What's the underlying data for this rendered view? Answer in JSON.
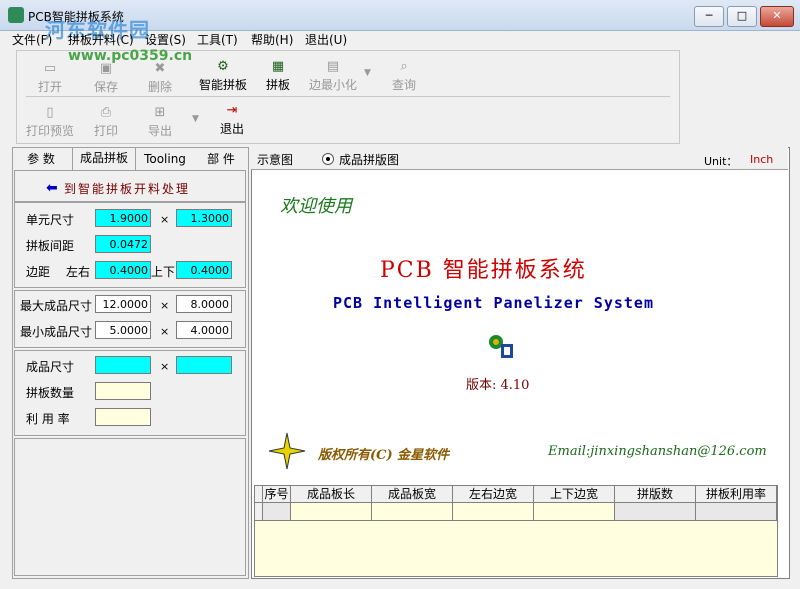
{
  "window": {
    "title": "PCB智能拼板系统"
  },
  "watermark": {
    "text": "河东软件园",
    "url": "www.pc0359.cn"
  },
  "menu": {
    "items": [
      "文件(F)",
      "拼板开料(C)",
      "设置(S)",
      "工具(T)",
      "帮助(H)",
      "退出(U)"
    ]
  },
  "toolbar": {
    "open": "打开",
    "save": "保存",
    "delete": "删除",
    "smart": "智能拼板",
    "panel": "拼板",
    "edge": "边最小化",
    "query": "查询",
    "preview": "打印预览",
    "print": "打印",
    "export": "导出",
    "exit": "退出"
  },
  "tabs": [
    "参 数",
    "成品拼板",
    "Tooling",
    "部 件"
  ],
  "left": {
    "link": "到智能拼板开料处理",
    "unit_size_label": "单元尺寸",
    "unit_w": "1.9000",
    "unit_h": "1.3000",
    "gap_label": "拼板间距",
    "gap": "0.0472",
    "margin_label": "边距",
    "lr_label": "左右",
    "lr": "0.4000",
    "ud_label": "上下",
    "ud": "0.4000",
    "max_label": "最大成品尺寸",
    "max_w": "12.0000",
    "max_h": "8.0000",
    "min_label": "最小成品尺寸",
    "min_w": "5.0000",
    "min_h": "4.0000",
    "prod_label": "成品尺寸",
    "count_label": "拼板数量",
    "usage_label": "利 用 率",
    "times": "×"
  },
  "right": {
    "view1": "示意图",
    "view2": "成品拼版图",
    "unit_label": "Unit：",
    "unit_value": "Inch",
    "welcome": "欢迎使用",
    "title_cn": "PCB 智能拼板系统",
    "title_en": "PCB Intelligent Panelizer System",
    "version": "版本: 4.10",
    "copyright": "版权所有(C) 金星软件",
    "email": "Email:jinxingshanshan@126.com"
  },
  "grid": {
    "headers": [
      "序号",
      "成品板长",
      "成品板宽",
      "左右边宽",
      "上下边宽",
      "拼版数",
      "拼板利用率"
    ]
  },
  "colors": {
    "cyan": "#00ffff",
    "yellow": "#ffffe0",
    "red_title": "#d00000"
  }
}
